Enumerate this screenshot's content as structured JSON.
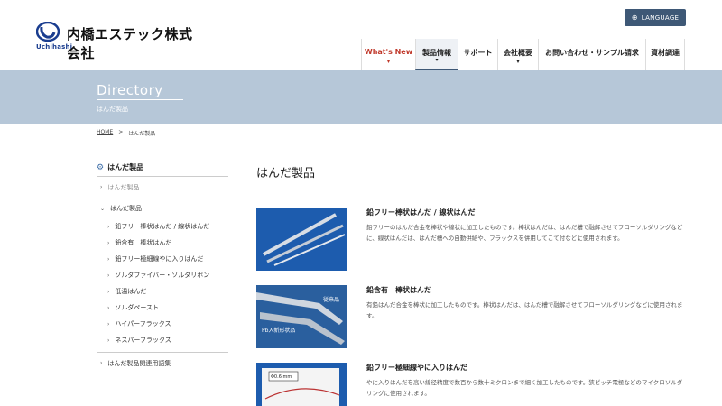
{
  "header": {
    "logo_name": "内橋エステック株式会社",
    "logo_sub": "Uchihashi",
    "language_label": "LANGUAGE",
    "nav": [
      {
        "label": "What's New"
      },
      {
        "label": "製品情報"
      },
      {
        "label": "サポート"
      },
      {
        "label": "会社概要"
      },
      {
        "label": "お問い合わせ・サンプル請求"
      },
      {
        "label": "資材調達"
      }
    ]
  },
  "banner": {
    "title": "Directory",
    "subtitle": "はんだ製品"
  },
  "breadcrumb": {
    "home": "HOME",
    "current": "はんだ製品"
  },
  "sidebar": {
    "heading": "はんだ製品",
    "top_link": "はんだ製品",
    "group_label": "はんだ製品",
    "sub_items": [
      "鉛フリー棒状はんだ / 線状はんだ",
      "鉛含有　棒状はんだ",
      "鉛フリー極細線やに入りはんだ",
      "ソルダファイバー・ソルダリボン",
      "低温はんだ",
      "ソルダペースト",
      "ハイパーフラックス",
      "ネスパーフラックス"
    ],
    "last_link": "はんだ製品関連用語集"
  },
  "main": {
    "title": "はんだ製品",
    "products": [
      {
        "title": "鉛フリー棒状はんだ / 線状はんだ",
        "desc": "鉛フリーのはんだ合金を棒状や線状に加工したものです。棒状はんだは、はんだ槽で融解させてフローソルダリングなどに、線状はんだは、はんだ槽への自動供給や、フラックスを併用してこて付などに使用されます。"
      },
      {
        "title": "鉛含有　棒状はんだ",
        "desc": "有鉛はんだ合金を棒状に加工したものです。棒状はんだは、はんだ槽で融解させてフローソルダリングなどに使用されます。",
        "img_label_1": "従来品",
        "img_label_2": "Pb入新形状品"
      },
      {
        "title": "鉛フリー極細線やに入りはんだ",
        "desc": "やに入りはんだを高い線径精度で数百から数十ミクロンまで細く加工したものです。狭ピッチ電極などのマイクロソルダリングに使用されます。",
        "img_label_1": "Φ0.6 mm"
      }
    ]
  }
}
